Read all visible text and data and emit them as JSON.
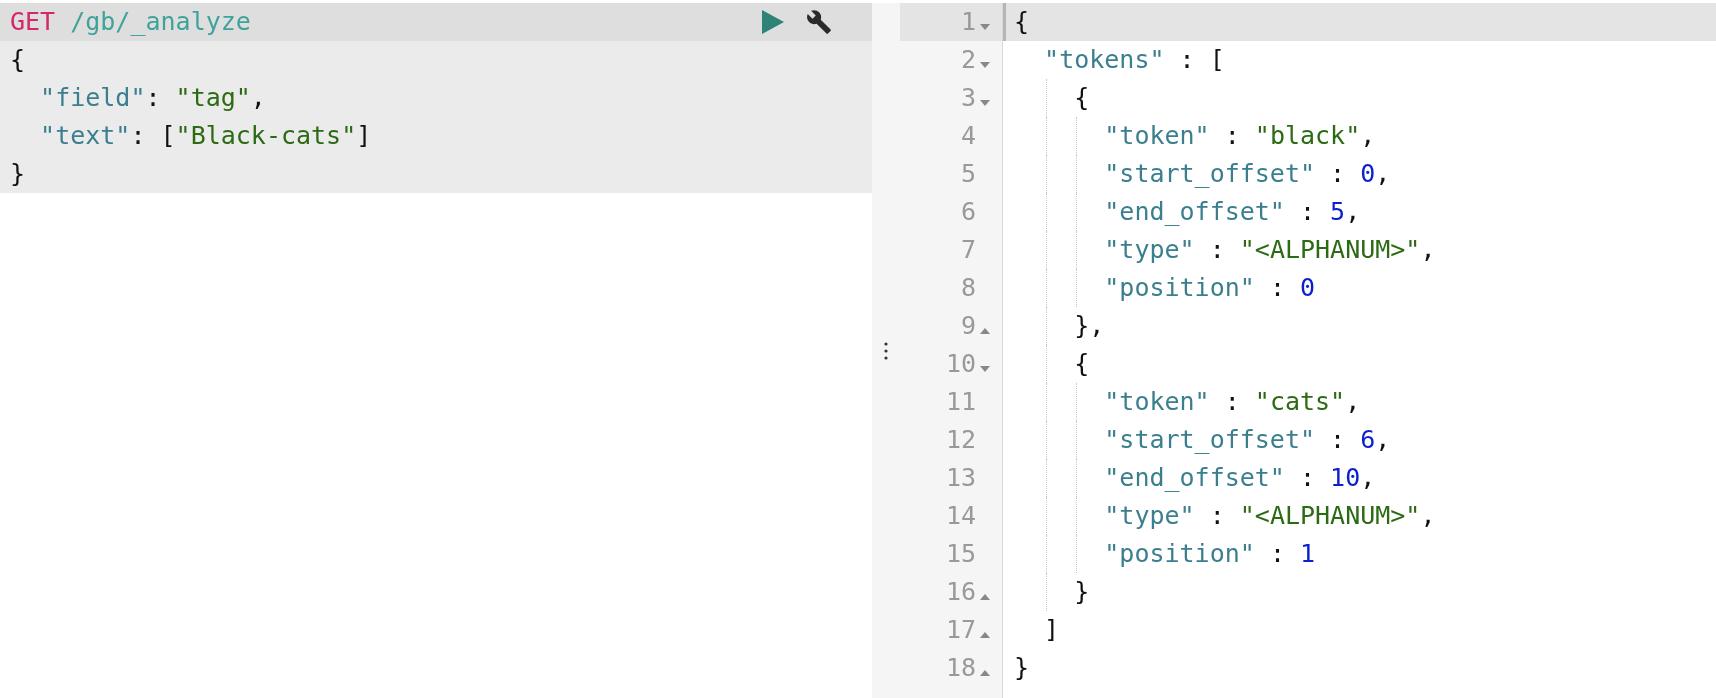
{
  "request": {
    "method": "GET",
    "path": "/gb/_analyze",
    "body": [
      [
        {
          "kind": "punct",
          "text": "{"
        }
      ],
      [
        {
          "kind": "key",
          "text": "  \"field\""
        },
        {
          "kind": "punct",
          "text": ": "
        },
        {
          "kind": "string",
          "text": "\"tag\""
        },
        {
          "kind": "punct",
          "text": ","
        }
      ],
      [
        {
          "kind": "key",
          "text": "  \"text\""
        },
        {
          "kind": "punct",
          "text": ": ["
        },
        {
          "kind": "string",
          "text": "\"Black-cats\""
        },
        {
          "kind": "punct",
          "text": "]"
        }
      ],
      [
        {
          "kind": "punct",
          "text": "}"
        }
      ]
    ]
  },
  "response": {
    "lines": [
      {
        "number": "1",
        "expanded": true,
        "active": true,
        "tokens": [
          {
            "kind": "punct",
            "text": "{"
          }
        ]
      },
      {
        "number": "2",
        "expanded": true,
        "active": false,
        "tokens": [
          {
            "kind": "key",
            "text": "  \"tokens\""
          },
          {
            "kind": "punct",
            "text": " : ["
          }
        ]
      },
      {
        "number": "3",
        "expanded": true,
        "active": false,
        "tokens": [
          {
            "kind": "punct",
            "text": "    {"
          }
        ]
      },
      {
        "number": "4",
        "active": false,
        "tokens": [
          {
            "kind": "key",
            "text": "      \"token\""
          },
          {
            "kind": "punct",
            "text": " : "
          },
          {
            "kind": "string",
            "text": "\"black\""
          },
          {
            "kind": "punct",
            "text": ","
          }
        ]
      },
      {
        "number": "5",
        "active": false,
        "tokens": [
          {
            "kind": "key",
            "text": "      \"start_offset\""
          },
          {
            "kind": "punct",
            "text": " : "
          },
          {
            "kind": "number",
            "text": "0"
          },
          {
            "kind": "punct",
            "text": ","
          }
        ]
      },
      {
        "number": "6",
        "active": false,
        "tokens": [
          {
            "kind": "key",
            "text": "      \"end_offset\""
          },
          {
            "kind": "punct",
            "text": " : "
          },
          {
            "kind": "number",
            "text": "5"
          },
          {
            "kind": "punct",
            "text": ","
          }
        ]
      },
      {
        "number": "7",
        "active": false,
        "tokens": [
          {
            "kind": "key",
            "text": "      \"type\""
          },
          {
            "kind": "punct",
            "text": " : "
          },
          {
            "kind": "string",
            "text": "\"<ALPHANUM>\""
          },
          {
            "kind": "punct",
            "text": ","
          }
        ]
      },
      {
        "number": "8",
        "active": false,
        "tokens": [
          {
            "kind": "key",
            "text": "      \"position\""
          },
          {
            "kind": "punct",
            "text": " : "
          },
          {
            "kind": "number",
            "text": "0"
          }
        ]
      },
      {
        "number": "9",
        "expanded": false,
        "active": false,
        "tokens": [
          {
            "kind": "punct",
            "text": "    },"
          }
        ]
      },
      {
        "number": "10",
        "expanded": true,
        "active": false,
        "tokens": [
          {
            "kind": "punct",
            "text": "    {"
          }
        ]
      },
      {
        "number": "11",
        "active": false,
        "tokens": [
          {
            "kind": "key",
            "text": "      \"token\""
          },
          {
            "kind": "punct",
            "text": " : "
          },
          {
            "kind": "string",
            "text": "\"cats\""
          },
          {
            "kind": "punct",
            "text": ","
          }
        ]
      },
      {
        "number": "12",
        "active": false,
        "tokens": [
          {
            "kind": "key",
            "text": "      \"start_offset\""
          },
          {
            "kind": "punct",
            "text": " : "
          },
          {
            "kind": "number",
            "text": "6"
          },
          {
            "kind": "punct",
            "text": ","
          }
        ]
      },
      {
        "number": "13",
        "active": false,
        "tokens": [
          {
            "kind": "key",
            "text": "      \"end_offset\""
          },
          {
            "kind": "punct",
            "text": " : "
          },
          {
            "kind": "number",
            "text": "10"
          },
          {
            "kind": "punct",
            "text": ","
          }
        ]
      },
      {
        "number": "14",
        "active": false,
        "tokens": [
          {
            "kind": "key",
            "text": "      \"type\""
          },
          {
            "kind": "punct",
            "text": " : "
          },
          {
            "kind": "string",
            "text": "\"<ALPHANUM>\""
          },
          {
            "kind": "punct",
            "text": ","
          }
        ]
      },
      {
        "number": "15",
        "active": false,
        "tokens": [
          {
            "kind": "key",
            "text": "      \"position\""
          },
          {
            "kind": "punct",
            "text": " : "
          },
          {
            "kind": "number",
            "text": "1"
          }
        ]
      },
      {
        "number": "16",
        "expanded": false,
        "active": false,
        "tokens": [
          {
            "kind": "punct",
            "text": "    }"
          }
        ]
      },
      {
        "number": "17",
        "expanded": false,
        "active": false,
        "tokens": [
          {
            "kind": "punct",
            "text": "  ]"
          }
        ]
      },
      {
        "number": "18",
        "expanded": false,
        "active": false,
        "tokens": [
          {
            "kind": "punct",
            "text": "}"
          }
        ]
      }
    ]
  }
}
